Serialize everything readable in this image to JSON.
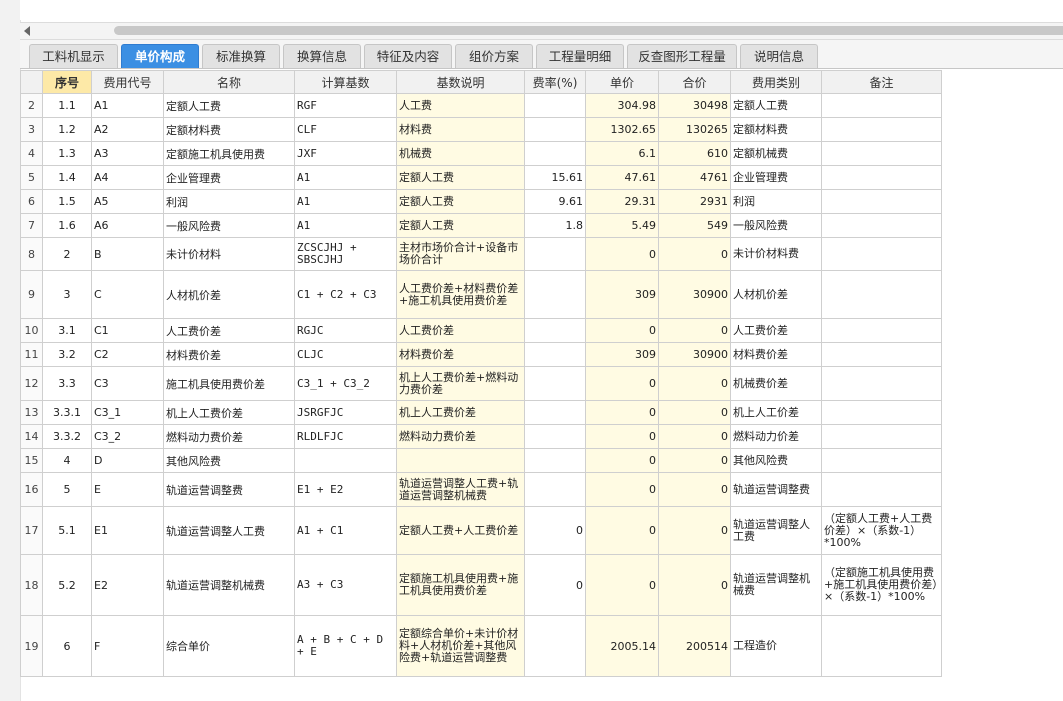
{
  "tabs": [
    {
      "label": "工料机显示",
      "active": false
    },
    {
      "label": "单价构成",
      "active": true
    },
    {
      "label": "标准换算",
      "active": false
    },
    {
      "label": "换算信息",
      "active": false
    },
    {
      "label": "特征及内容",
      "active": false
    },
    {
      "label": "组价方案",
      "active": false
    },
    {
      "label": "工程量明细",
      "active": false
    },
    {
      "label": "反查图形工程量",
      "active": false
    },
    {
      "label": "说明信息",
      "active": false
    }
  ],
  "columns": {
    "seq": "序号",
    "code": "费用代号",
    "name": "名称",
    "base": "计算基数",
    "desc": "基数说明",
    "rate": "费率(%)",
    "unit_price": "单价",
    "total": "合价",
    "category": "费用类别",
    "note": "备注"
  },
  "rows": [
    {
      "rn": "2",
      "seq": "1.1",
      "code": "A1",
      "name": "定额人工费",
      "base": "RGF",
      "desc": "人工费",
      "rate": "",
      "unit_price": "304.98",
      "total": "30498",
      "category": "定额人工费",
      "note": ""
    },
    {
      "rn": "3",
      "seq": "1.2",
      "code": "A2",
      "name": "定额材料费",
      "base": "CLF",
      "desc": "材料费",
      "rate": "",
      "unit_price": "1302.65",
      "total": "130265",
      "category": "定额材料费",
      "note": ""
    },
    {
      "rn": "4",
      "seq": "1.3",
      "code": "A3",
      "name": "定额施工机具使用费",
      "base": "JXF",
      "desc": "机械费",
      "rate": "",
      "unit_price": "6.1",
      "total": "610",
      "category": "定额机械费",
      "note": ""
    },
    {
      "rn": "5",
      "seq": "1.4",
      "code": "A4",
      "name": "企业管理费",
      "base": "A1",
      "desc": "定额人工费",
      "rate": "15.61",
      "unit_price": "47.61",
      "total": "4761",
      "category": "企业管理费",
      "note": ""
    },
    {
      "rn": "6",
      "seq": "1.5",
      "code": "A5",
      "name": "利润",
      "base": "A1",
      "desc": "定额人工费",
      "rate": "9.61",
      "unit_price": "29.31",
      "total": "2931",
      "category": "利润",
      "note": ""
    },
    {
      "rn": "7",
      "seq": "1.6",
      "code": "A6",
      "name": "一般风险费",
      "base": "A1",
      "desc": "定额人工费",
      "rate": "1.8",
      "unit_price": "5.49",
      "total": "549",
      "category": "一般风险费",
      "note": ""
    },
    {
      "rn": "8",
      "seq": "2",
      "code": "B",
      "name": "未计价材料",
      "base": "ZCSCJHJ + SBSCJHJ",
      "desc": "主材市场价合计+设备市场价合计",
      "rate": "",
      "unit_price": "0",
      "total": "0",
      "category": "未计价材料费",
      "note": ""
    },
    {
      "rn": "9",
      "seq": "3",
      "code": "C",
      "name": "人材机价差",
      "base": "C1 + C2 + C3",
      "desc": "人工费价差+材料费价差+施工机具使用费价差",
      "rate": "",
      "unit_price": "309",
      "total": "30900",
      "category": "人材机价差",
      "note": ""
    },
    {
      "rn": "10",
      "seq": "3.1",
      "code": "C1",
      "name": "人工费价差",
      "base": "RGJC",
      "desc": "人工费价差",
      "rate": "",
      "unit_price": "0",
      "total": "0",
      "category": "人工费价差",
      "note": ""
    },
    {
      "rn": "11",
      "seq": "3.2",
      "code": "C2",
      "name": "材料费价差",
      "base": "CLJC",
      "desc": "材料费价差",
      "rate": "",
      "unit_price": "309",
      "total": "30900",
      "category": "材料费价差",
      "note": ""
    },
    {
      "rn": "12",
      "seq": "3.3",
      "code": "C3",
      "name": "施工机具使用费价差",
      "base": "C3_1 + C3_2",
      "desc": "机上人工费价差+燃料动力费价差",
      "rate": "",
      "unit_price": "0",
      "total": "0",
      "category": "机械费价差",
      "note": ""
    },
    {
      "rn": "13",
      "seq": "3.3.1",
      "code": "C3_1",
      "name": "机上人工费价差",
      "base": "JSRGFJC",
      "desc": "机上人工费价差",
      "rate": "",
      "unit_price": "0",
      "total": "0",
      "category": "机上人工价差",
      "note": ""
    },
    {
      "rn": "14",
      "seq": "3.3.2",
      "code": "C3_2",
      "name": "燃料动力费价差",
      "base": "RLDLFJC",
      "desc": "燃料动力费价差",
      "rate": "",
      "unit_price": "0",
      "total": "0",
      "category": "燃料动力价差",
      "note": ""
    },
    {
      "rn": "15",
      "seq": "4",
      "code": "D",
      "name": "其他风险费",
      "base": "",
      "desc": "",
      "rate": "",
      "unit_price": "0",
      "total": "0",
      "category": "其他风险费",
      "note": ""
    },
    {
      "rn": "16",
      "seq": "5",
      "code": "E",
      "name": "轨道运营调整费",
      "base": "E1 + E2",
      "desc": "轨道运营调整人工费+轨道运营调整机械费",
      "rate": "",
      "unit_price": "0",
      "total": "0",
      "category": "轨道运营调整费",
      "note": ""
    },
    {
      "rn": "17",
      "seq": "5.1",
      "code": "E1",
      "name": "轨道运营调整人工费",
      "base": "A1 + C1",
      "desc": "定额人工费+人工费价差",
      "rate": "0",
      "unit_price": "0",
      "total": "0",
      "category": "轨道运营调整人工费",
      "note": "（定额人工费+人工费价差）×（系数-1）*100%"
    },
    {
      "rn": "18",
      "seq": "5.2",
      "code": "E2",
      "name": "轨道运营调整机械费",
      "base": "A3 + C3",
      "desc": "定额施工机具使用费+施工机具使用费价差",
      "rate": "0",
      "unit_price": "0",
      "total": "0",
      "category": "轨道运营调整机械费",
      "note": "（定额施工机具使用费+施工机具使用费价差）×（系数-1）*100%"
    },
    {
      "rn": "19",
      "seq": "6",
      "code": "F",
      "name": "综合单价",
      "base": "A + B + C + D + E",
      "desc": "定额综合单价+未计价材料+人材机价差+其他风险费+轨道运营调整费",
      "rate": "",
      "unit_price": "2005.14",
      "total": "200514",
      "category": "工程造价",
      "note": ""
    }
  ]
}
